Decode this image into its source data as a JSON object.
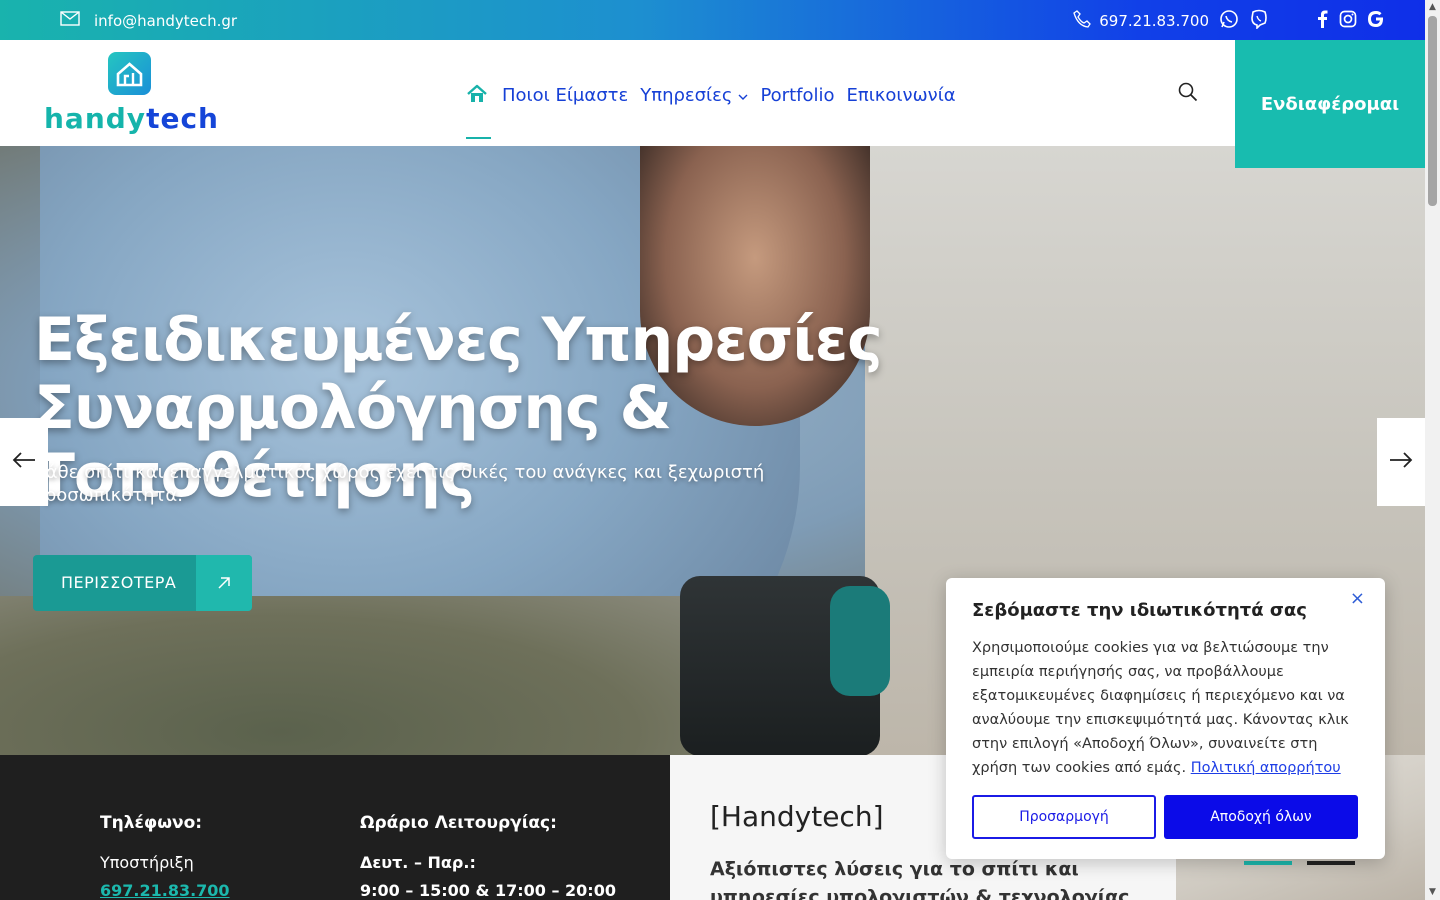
{
  "topbar": {
    "email": "info@handytech.gr",
    "phone": "697.21.83.700",
    "icons": [
      "mail-icon",
      "phone-icon",
      "whatsapp-icon",
      "viber-icon",
      "facebook-icon",
      "instagram-icon",
      "google-icon"
    ]
  },
  "header": {
    "logo_text_a": "handy",
    "logo_text_b": "tech",
    "nav": {
      "home_icon": "home-icon",
      "about": "Ποιοι Είμαστε",
      "services": "Υπηρεσίες",
      "portfolio": "Portfolio",
      "contact": "Επικοινωνία"
    },
    "cta": "Ενδιαφέρομαι"
  },
  "hero": {
    "title_line1": "Εξειδικευμένες Υπηρεσίες",
    "title_line2": "Συναρμολόγησης & Τοποθέτησης",
    "subtitle": "Κάθε σπίτι και επαγγελματικός χώρος έχει τις δικές του ανάγκες και ξεχωριστή προσωπικότητα.",
    "button": "ΠΕΡΙΣΣΟΤΕΡΑ"
  },
  "info": {
    "phone_title": "Τηλέφωνο:",
    "phone_label": "Υποστήριξη",
    "phone_number": "697.21.83.700",
    "hours_title": "Ωράριο Λειτουργίας:",
    "hours_days": "Δευτ. – Παρ.:",
    "hours_time": "9:00 – 15:00 & 17:00 – 20:00",
    "brand": "[Handytech]",
    "tagline": "Αξιόπιστες λύσεις για το σπίτι και υπηρεσίες υπολογιστών & τεχνολογίας"
  },
  "cookie": {
    "title": "Σεβόμαστε την ιδιωτικότητά σας",
    "body": "Χρησιμοποιούμε cookies για να βελτιώσουμε την εμπειρία περιήγησής σας, να προβάλλουμε εξατομικευμένες διαφημίσεις ή περιεχόμενο και να αναλύουμε την επισκεψιμότητά μας. Κάνοντας κλικ στην επιλογή «Αποδοχή Όλων», συναινείτε στη χρήση των cookies από εμάς.",
    "policy_link": "Πολιτική απορρήτου",
    "customize": "Προσαρμογή",
    "accept": "Αποδοχή όλων",
    "close": "×"
  },
  "colors": {
    "teal": "#18bcaf",
    "blue": "#1640d6",
    "dark": "#1f1f1f"
  }
}
